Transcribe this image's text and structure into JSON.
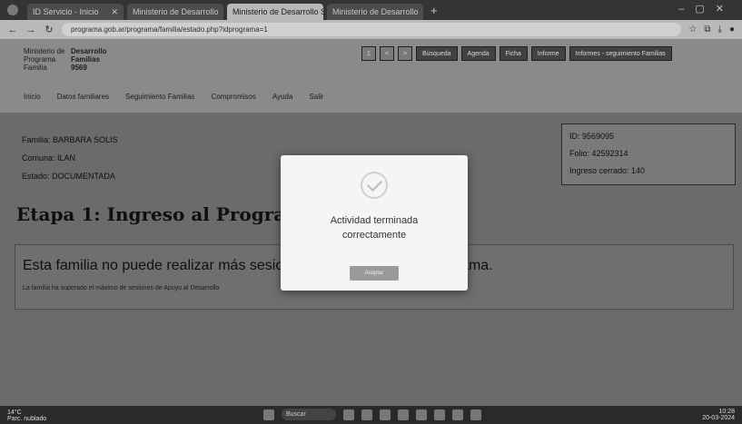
{
  "browser": {
    "tabs": [
      {
        "label": "ID Servicio - Inicio"
      },
      {
        "label": "Ministerio de Desarrollo"
      },
      {
        "label": "Ministerio de Desarrollo Soc"
      },
      {
        "label": "Ministerio de Desarrollo"
      }
    ],
    "url": "programa.gob.ar/programa/familia/estado.php?idprograma=1"
  },
  "header": {
    "info": [
      {
        "key": "Ministerio de",
        "value": "Desarrollo"
      },
      {
        "key": "Programa",
        "value": "Familias"
      },
      {
        "key": "Familia",
        "value": "9569"
      }
    ],
    "menu": [
      "Inicio",
      "Datos familiares",
      "Seguimiento Familias",
      "Compromisos",
      "Ayuda",
      "Salir"
    ],
    "toolbar": {
      "btn_small_1": "1",
      "btn_small_2": "<",
      "btn_small_3": ">",
      "btn_a": "Búsqueda",
      "btn_b": "Agenda",
      "btn_c": "Ficha",
      "btn_d": "Informe",
      "btn_e": "Informes - seguimiento Familias"
    }
  },
  "family": {
    "lines": [
      "Familia: BARBARA SOLIS",
      "Comuna: ILAN",
      "Estado: DOCUMENTADA"
    ]
  },
  "idbox": {
    "lines": [
      "ID: 9569095",
      "Folio: 42592314",
      "Ingreso cerrado: 140"
    ]
  },
  "stage": {
    "title": "Etapa 1: Ingreso al Programa"
  },
  "notice": {
    "main": "Esta familia no puede realizar más sesiones en esta etapa del programa.",
    "sub": "La familia ha superado el máximo de sesiones de Apoyo al Desarrollo"
  },
  "modal": {
    "message": "Actividad terminada correctamente",
    "button": "Aceptar"
  },
  "taskbar": {
    "weather_temp": "14°C",
    "weather_desc": "Parc. nublado",
    "search": "Buscar",
    "time": "10:28",
    "date": "20-03-2024"
  }
}
